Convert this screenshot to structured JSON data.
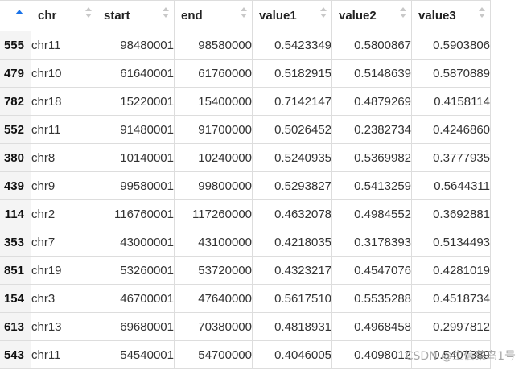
{
  "table": {
    "headers": {
      "rowname": "",
      "chr": "chr",
      "start": "start",
      "end": "end",
      "value1": "value1",
      "value2": "value2",
      "value3": "value3"
    },
    "rows": [
      {
        "rowname": "555",
        "chr": "chr11",
        "start": "98480001",
        "end": "98580000",
        "value1": "0.5423349",
        "value2": "0.5800867",
        "value3": "0.5903806"
      },
      {
        "rowname": "479",
        "chr": "chr10",
        "start": "61640001",
        "end": "61760000",
        "value1": "0.5182915",
        "value2": "0.5148639",
        "value3": "0.5870889"
      },
      {
        "rowname": "782",
        "chr": "chr18",
        "start": "15220001",
        "end": "15400000",
        "value1": "0.7142147",
        "value2": "0.4879269",
        "value3": "0.4158114"
      },
      {
        "rowname": "552",
        "chr": "chr11",
        "start": "91480001",
        "end": "91700000",
        "value1": "0.5026452",
        "value2": "0.2382734",
        "value3": "0.4246860"
      },
      {
        "rowname": "380",
        "chr": "chr8",
        "start": "10140001",
        "end": "10240000",
        "value1": "0.5240935",
        "value2": "0.5369982",
        "value3": "0.3777935"
      },
      {
        "rowname": "439",
        "chr": "chr9",
        "start": "99580001",
        "end": "99800000",
        "value1": "0.5293827",
        "value2": "0.5413259",
        "value3": "0.5644311"
      },
      {
        "rowname": "114",
        "chr": "chr2",
        "start": "116760001",
        "end": "117260000",
        "value1": "0.4632078",
        "value2": "0.4984552",
        "value3": "0.3692881"
      },
      {
        "rowname": "353",
        "chr": "chr7",
        "start": "43000001",
        "end": "43100000",
        "value1": "0.4218035",
        "value2": "0.3178393",
        "value3": "0.5134493"
      },
      {
        "rowname": "851",
        "chr": "chr19",
        "start": "53260001",
        "end": "53720000",
        "value1": "0.4323217",
        "value2": "0.4547076",
        "value3": "0.4281019"
      },
      {
        "rowname": "154",
        "chr": "chr3",
        "start": "46700001",
        "end": "47640000",
        "value1": "0.5617510",
        "value2": "0.5535288",
        "value3": "0.4518734"
      },
      {
        "rowname": "613",
        "chr": "chr13",
        "start": "69680001",
        "end": "70380000",
        "value1": "0.4818931",
        "value2": "0.4968458",
        "value3": "0.2997812"
      },
      {
        "rowname": "543",
        "chr": "chr11",
        "start": "54540001",
        "end": "54700000",
        "value1": "0.4046005",
        "value2": "0.4098012",
        "value3": "0.5407389"
      }
    ],
    "sort": {
      "column": "rowname",
      "direction": "ascending"
    },
    "accent_color": "#1a73e8"
  },
  "watermark": "CSDN @生信菜鸟1号"
}
